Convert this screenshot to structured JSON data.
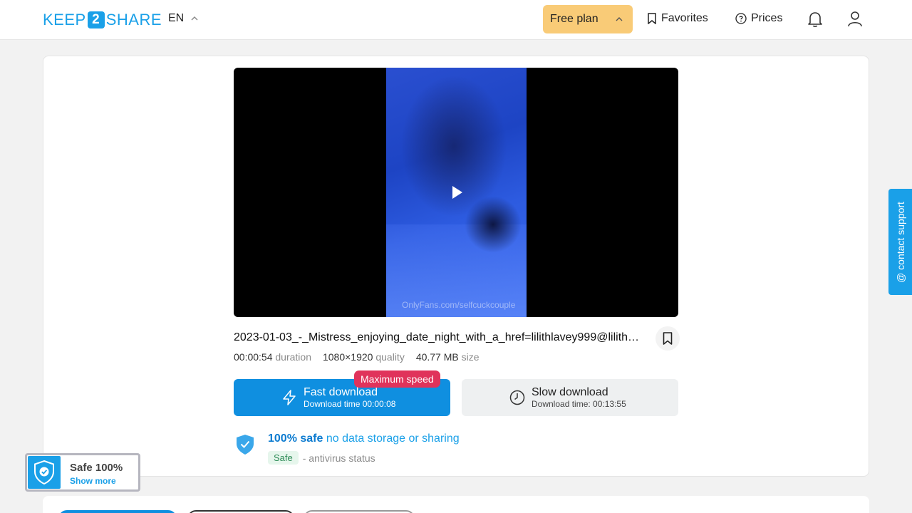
{
  "header": {
    "logo_left": "KEEP",
    "logo_mid": "2",
    "logo_right": "SHARE",
    "language": "EN",
    "free_plan_label": "Free plan",
    "favorites_label": "Favorites",
    "prices_label": "Prices"
  },
  "video": {
    "watermark": "OnlyFans.com/selfcuckcouple"
  },
  "file": {
    "name": "2023-01-03_-_Mistress_enjoying_date_night_with_a_href=lilithlavey999@lilith…",
    "duration_value": "00:00:54",
    "duration_label": "duration",
    "quality_value": "1080×1920",
    "quality_label": "quality",
    "size_value": "40.77 MB",
    "size_label": "size"
  },
  "download": {
    "fast_label": "Fast download",
    "fast_time": "Download time 00:00:08",
    "max_speed_badge": "Maximum speed",
    "slow_label": "Slow download",
    "slow_time": "Download time: 00:13:55"
  },
  "safety": {
    "strong": "100% safe",
    "rest": "no data storage or sharing",
    "badge": "Safe",
    "status_text": "- antivirus status"
  },
  "support": {
    "label": "@ contact support"
  },
  "safe_widget": {
    "title": "Safe 100%",
    "more": "Show more"
  },
  "colors": {
    "brand": "#1aa0e8",
    "fast_button": "#0f8fe0",
    "free_plan": "#f9cb77",
    "max_speed": "#e0335b"
  }
}
